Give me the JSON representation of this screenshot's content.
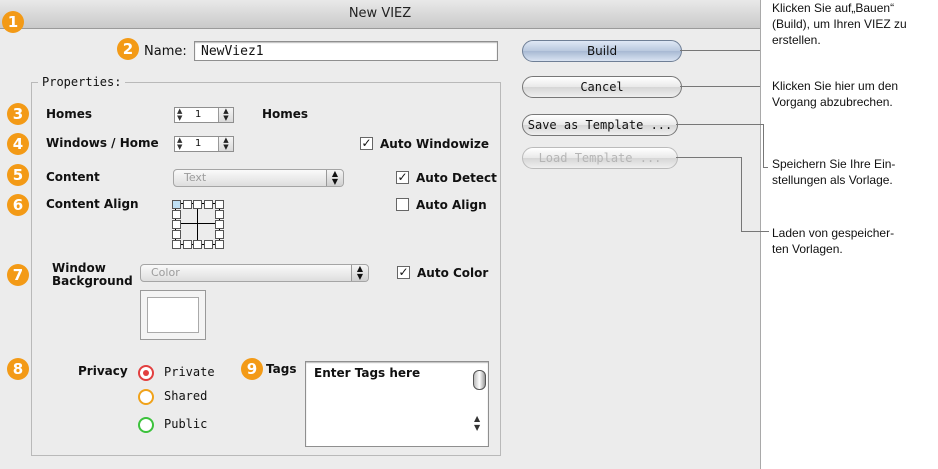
{
  "window": {
    "title": "New VIEZ"
  },
  "markers": [
    "1",
    "2",
    "3",
    "4",
    "5",
    "6",
    "7",
    "8",
    "9"
  ],
  "name": {
    "label": "Name:",
    "value": "NewViez1"
  },
  "properties": {
    "legend": "Properties:",
    "homes": {
      "label": "Homes",
      "value": "1",
      "unit": "Homes"
    },
    "windows": {
      "label": "Windows / Home",
      "value": "1",
      "check_label": "Auto Windowize",
      "checked": true
    },
    "content": {
      "label": "Content",
      "value": "Text",
      "check_label": "Auto Detect",
      "checked": true
    },
    "content_align": {
      "label": "Content Align",
      "check_label": "Auto Align",
      "checked": false
    },
    "background": {
      "label_line1": "Window",
      "label_line2": "Background",
      "value": "Color",
      "check_label": "Auto Color",
      "checked": true
    },
    "privacy": {
      "label": "Privacy",
      "options": [
        {
          "label": "Private",
          "selected": true,
          "color": "#e24040"
        },
        {
          "label": "Shared",
          "selected": false,
          "color": "#f0a21a"
        },
        {
          "label": "Public",
          "selected": false,
          "color": "#3cc23c"
        }
      ]
    },
    "tags": {
      "label": "Tags",
      "value": "Enter Tags here"
    }
  },
  "buttons": {
    "build": "Build",
    "cancel": "Cancel",
    "save_template": "Save as Template ...",
    "load_template": "Load Template ..."
  },
  "annotations": {
    "build": [
      "Klicken Sie auf„Bauen“",
      "(Build), um Ihren VIEZ zu",
      "erstellen."
    ],
    "cancel": [
      "Klicken Sie hier um den",
      "Vorgang abzubrechen."
    ],
    "save": [
      "Speichern Sie Ihre Ein-",
      "stellungen als Vorlage."
    ],
    "load": [
      "Laden von gespeicher-",
      "ten Vorlagen."
    ]
  },
  "colors": {
    "marker": "#f39a16",
    "default_button": "#b9c8de"
  }
}
